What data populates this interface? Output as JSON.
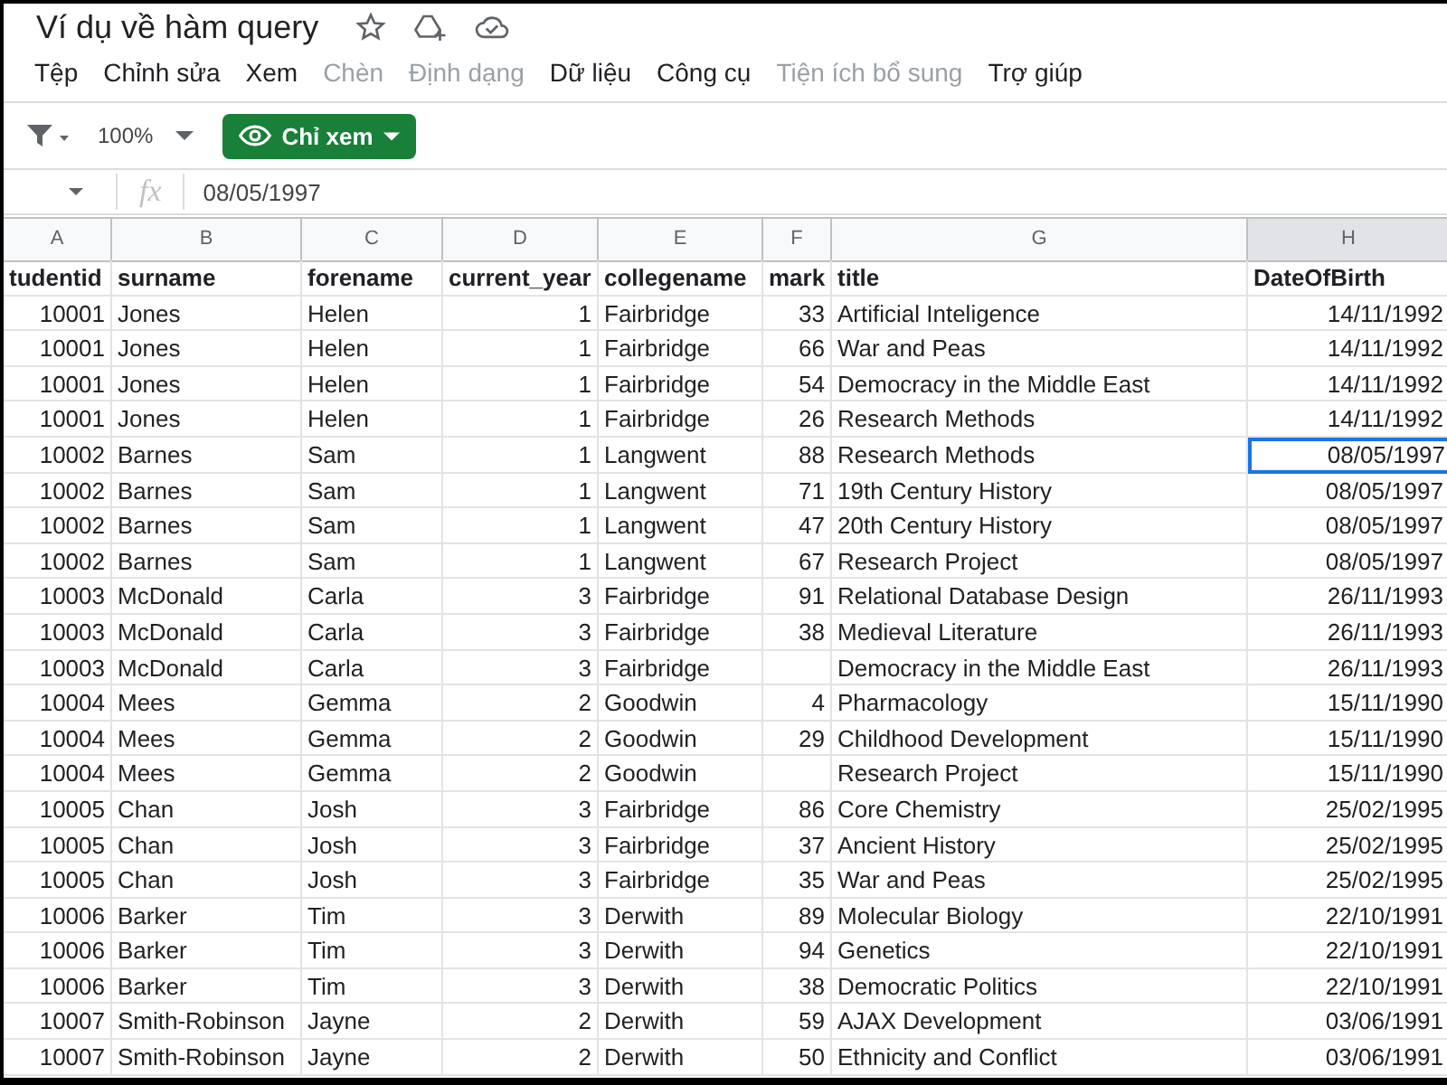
{
  "window": {
    "title": "Ví dụ về hàm query"
  },
  "menu": [
    {
      "label": "Tệp",
      "disabled": false
    },
    {
      "label": "Chỉnh sửa",
      "disabled": false
    },
    {
      "label": "Xem",
      "disabled": false
    },
    {
      "label": "Chèn",
      "disabled": true
    },
    {
      "label": "Định dạng",
      "disabled": true
    },
    {
      "label": "Dữ liệu",
      "disabled": false
    },
    {
      "label": "Công cụ",
      "disabled": false
    },
    {
      "label": "Tiện ích bổ sung",
      "disabled": true
    },
    {
      "label": "Trợ giúp",
      "disabled": false
    }
  ],
  "toolbar": {
    "zoom": "100%",
    "view_button": "Chỉ xem"
  },
  "formula_bar": {
    "fx": "fx",
    "value": "08/05/1997"
  },
  "table": {
    "columns": [
      {
        "letter": "A",
        "kind": "number",
        "selected": false
      },
      {
        "letter": "B",
        "kind": "text",
        "selected": false
      },
      {
        "letter": "C",
        "kind": "text",
        "selected": false
      },
      {
        "letter": "D",
        "kind": "number",
        "selected": false
      },
      {
        "letter": "E",
        "kind": "text",
        "selected": false
      },
      {
        "letter": "F",
        "kind": "number",
        "selected": false
      },
      {
        "letter": "G",
        "kind": "text",
        "selected": false
      },
      {
        "letter": "H",
        "kind": "date",
        "selected": true
      }
    ],
    "header_row": [
      "tudentid",
      "surname",
      "forename",
      "current_year",
      "collegename",
      "mark",
      "title",
      "DateOfBirth"
    ],
    "rows": [
      {
        "cells": [
          "10001",
          "Jones",
          "Helen",
          "1",
          "Fairbridge",
          "33",
          "Artificial Inteligence",
          "14/11/1992"
        ],
        "selected": false
      },
      {
        "cells": [
          "10001",
          "Jones",
          "Helen",
          "1",
          "Fairbridge",
          "66",
          "War and Peas",
          "14/11/1992"
        ],
        "selected": false
      },
      {
        "cells": [
          "10001",
          "Jones",
          "Helen",
          "1",
          "Fairbridge",
          "54",
          "Democracy in the Middle East",
          "14/11/1992"
        ],
        "selected": false
      },
      {
        "cells": [
          "10001",
          "Jones",
          "Helen",
          "1",
          "Fairbridge",
          "26",
          "Research Methods",
          "14/11/1992"
        ],
        "selected": false
      },
      {
        "cells": [
          "10002",
          "Barnes",
          "Sam",
          "1",
          "Langwent",
          "88",
          "Research Methods",
          "08/05/1997"
        ],
        "selected": true
      },
      {
        "cells": [
          "10002",
          "Barnes",
          "Sam",
          "1",
          "Langwent",
          "71",
          "19th Century History",
          "08/05/1997"
        ],
        "selected": false
      },
      {
        "cells": [
          "10002",
          "Barnes",
          "Sam",
          "1",
          "Langwent",
          "47",
          "20th Century History",
          "08/05/1997"
        ],
        "selected": false
      },
      {
        "cells": [
          "10002",
          "Barnes",
          "Sam",
          "1",
          "Langwent",
          "67",
          "Research Project",
          "08/05/1997"
        ],
        "selected": false
      },
      {
        "cells": [
          "10003",
          "McDonald",
          "Carla",
          "3",
          "Fairbridge",
          "91",
          "Relational Database Design",
          "26/11/1993"
        ],
        "selected": false
      },
      {
        "cells": [
          "10003",
          "McDonald",
          "Carla",
          "3",
          "Fairbridge",
          "38",
          "Medieval Literature",
          "26/11/1993"
        ],
        "selected": false
      },
      {
        "cells": [
          "10003",
          "McDonald",
          "Carla",
          "3",
          "Fairbridge",
          "",
          "Democracy in the Middle East",
          "26/11/1993"
        ],
        "selected": false
      },
      {
        "cells": [
          "10004",
          "Mees",
          "Gemma",
          "2",
          "Goodwin",
          "4",
          "Pharmacology",
          "15/11/1990"
        ],
        "selected": false
      },
      {
        "cells": [
          "10004",
          "Mees",
          "Gemma",
          "2",
          "Goodwin",
          "29",
          "Childhood Development",
          "15/11/1990"
        ],
        "selected": false
      },
      {
        "cells": [
          "10004",
          "Mees",
          "Gemma",
          "2",
          "Goodwin",
          "",
          "Research Project",
          "15/11/1990"
        ],
        "selected": false
      },
      {
        "cells": [
          "10005",
          "Chan",
          "Josh",
          "3",
          "Fairbridge",
          "86",
          "Core Chemistry",
          "25/02/1995"
        ],
        "selected": false
      },
      {
        "cells": [
          "10005",
          "Chan",
          "Josh",
          "3",
          "Fairbridge",
          "37",
          "Ancient History",
          "25/02/1995"
        ],
        "selected": false
      },
      {
        "cells": [
          "10005",
          "Chan",
          "Josh",
          "3",
          "Fairbridge",
          "35",
          "War and Peas",
          "25/02/1995"
        ],
        "selected": false
      },
      {
        "cells": [
          "10006",
          "Barker",
          "Tim",
          "3",
          "Derwith",
          "89",
          "Molecular Biology",
          "22/10/1991"
        ],
        "selected": false
      },
      {
        "cells": [
          "10006",
          "Barker",
          "Tim",
          "3",
          "Derwith",
          "94",
          "Genetics",
          "22/10/1991"
        ],
        "selected": false
      },
      {
        "cells": [
          "10006",
          "Barker",
          "Tim",
          "3",
          "Derwith",
          "38",
          "Democratic Politics",
          "22/10/1991"
        ],
        "selected": false
      },
      {
        "cells": [
          "10007",
          "Smith-Robinson",
          "Jayne",
          "2",
          "Derwith",
          "59",
          "AJAX Development",
          "03/06/1991"
        ],
        "selected": false
      },
      {
        "cells": [
          "10007",
          "Smith-Robinson",
          "Jayne",
          "2",
          "Derwith",
          "50",
          "Ethnicity and Conflict",
          "03/06/1991"
        ],
        "selected": false
      }
    ]
  }
}
